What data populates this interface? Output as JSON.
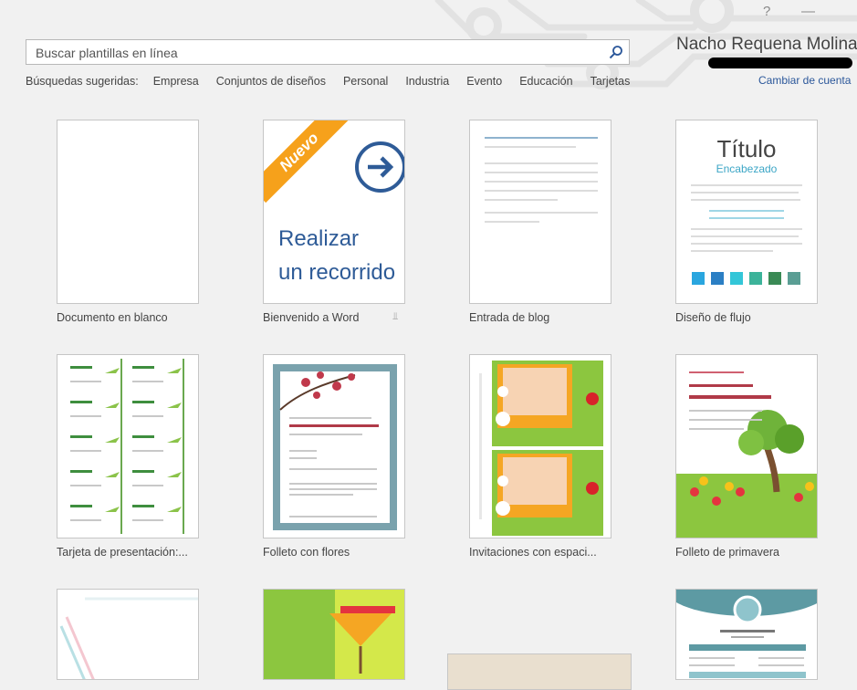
{
  "window": {
    "help_label": "?",
    "minimize_label": "—"
  },
  "search": {
    "placeholder": "Buscar plantillas en línea",
    "value": ""
  },
  "suggestions": {
    "label": "Búsquedas sugeridas:",
    "items": [
      "Empresa",
      "Conjuntos de diseños",
      "Personal",
      "Industria",
      "Evento",
      "Educación",
      "Tarjetas"
    ]
  },
  "account": {
    "name": "Nacho Requena Molina",
    "change_label": "Cambiar de cuenta"
  },
  "templates": [
    {
      "caption": "Documento en blanco"
    },
    {
      "caption": "Bienvenido a Word",
      "badge": "Nuevo",
      "line1": "Realizar",
      "line2": "un recorrido"
    },
    {
      "caption": "Entrada de blog"
    },
    {
      "caption": "Diseño de flujo",
      "title": "Título",
      "subtitle": "Encabezado"
    },
    {
      "caption": "Tarjeta de presentación:..."
    },
    {
      "caption": "Folleto con flores"
    },
    {
      "caption": "Invitaciones con espaci..."
    },
    {
      "caption": "Folleto de primavera"
    }
  ],
  "colors": {
    "accent_blue": "#2b579a",
    "tour_blue": "#2e5b97",
    "badge_orange": "#f6a11b",
    "swatches": [
      "#2aa6df",
      "#2b7fc4",
      "#33c6d8",
      "#3cb39a",
      "#3a8a55",
      "#5a9e94"
    ]
  }
}
